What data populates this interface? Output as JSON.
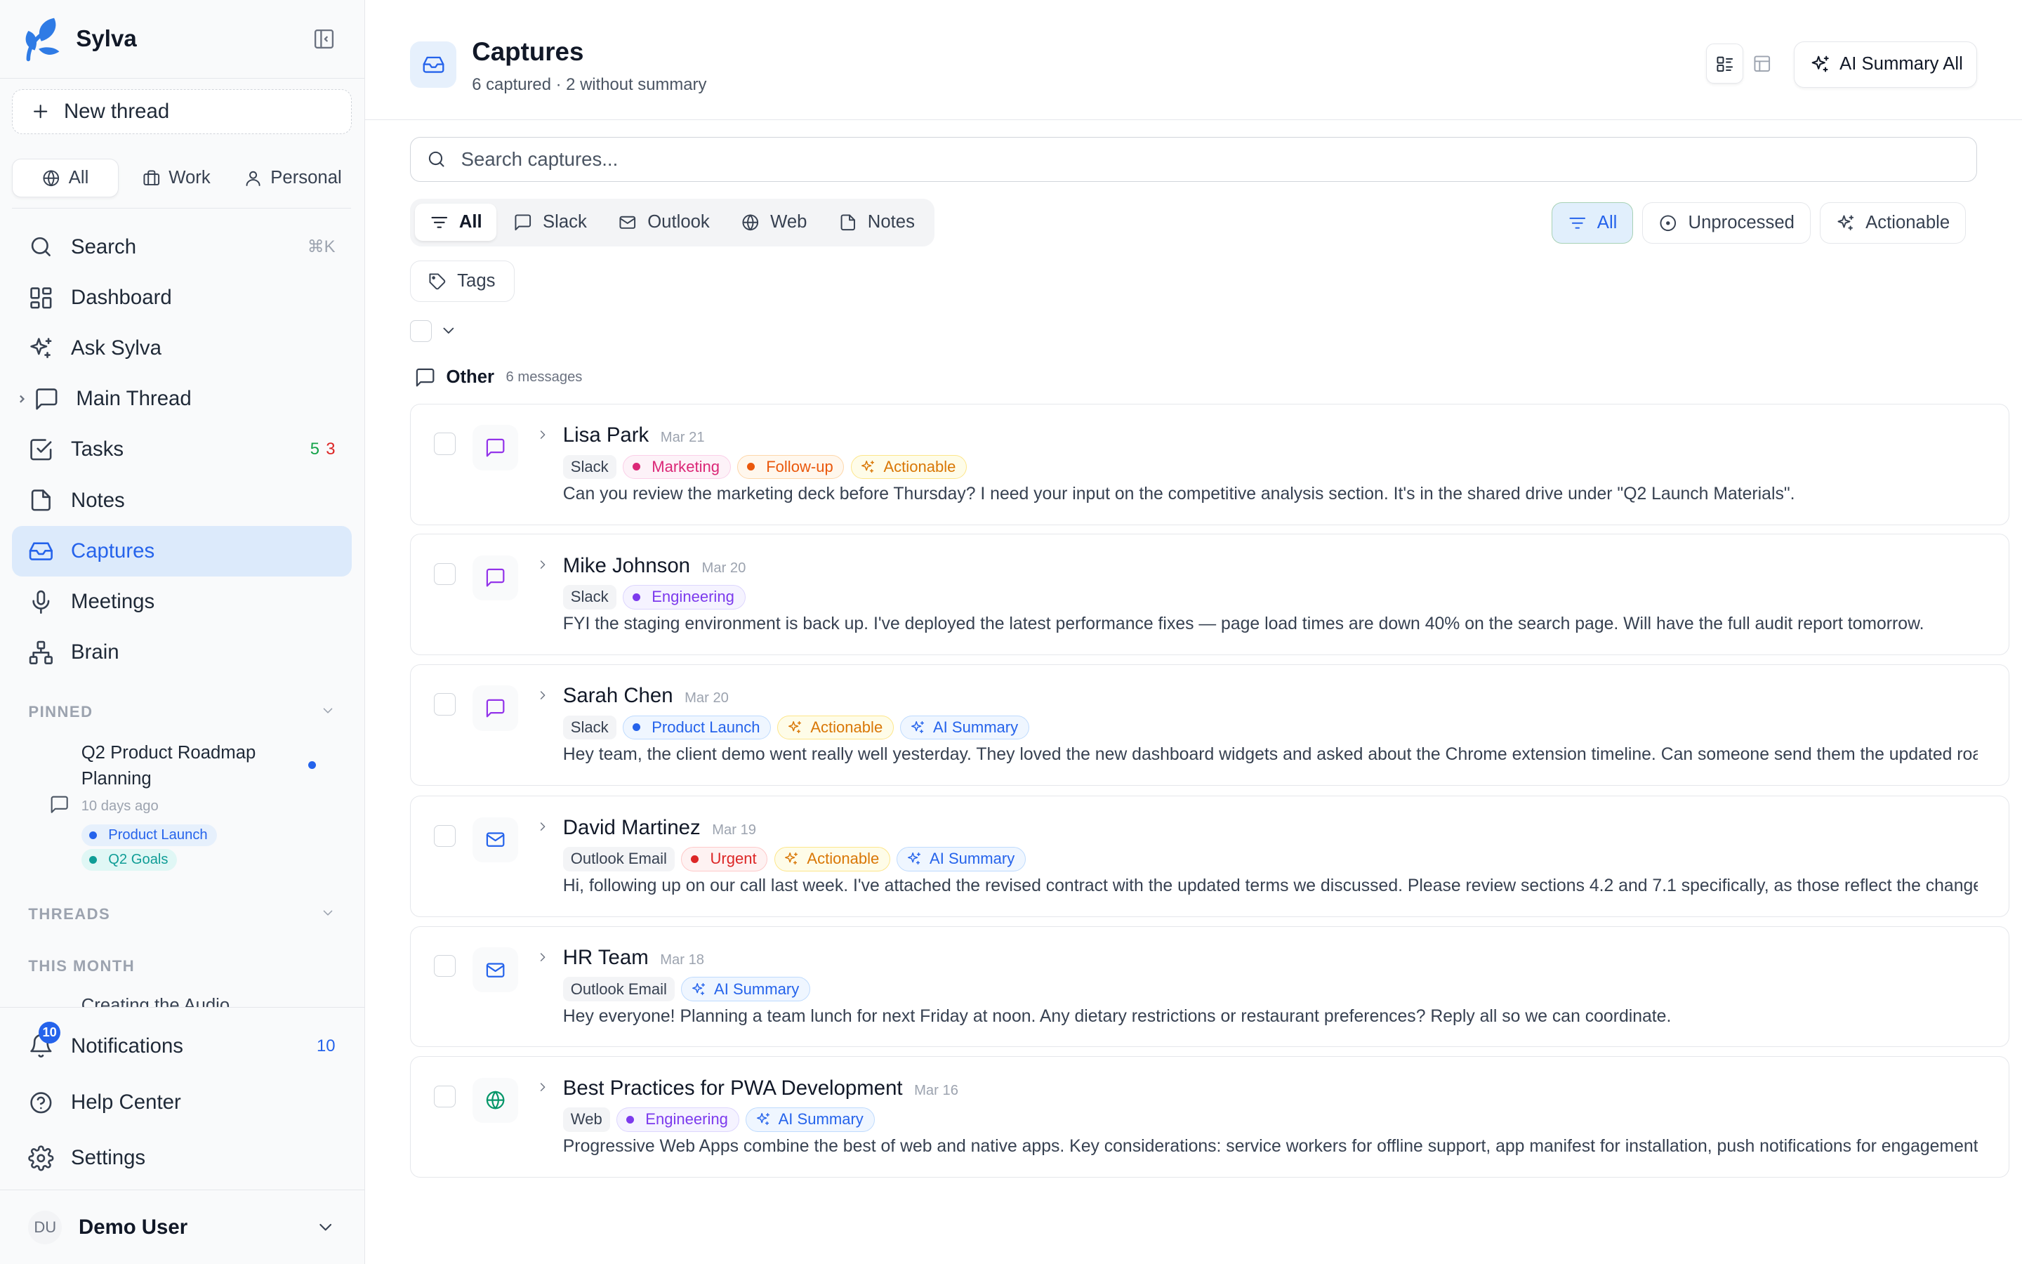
{
  "app": {
    "name": "Sylva"
  },
  "sidebar": {
    "new_thread": "New thread",
    "scopes": [
      {
        "label": "All"
      },
      {
        "label": "Work"
      },
      {
        "label": "Personal"
      }
    ],
    "nav": [
      {
        "label": "Search",
        "kbd": "⌘K",
        "icon": "search-icon"
      },
      {
        "label": "Dashboard",
        "icon": "dashboard-icon"
      },
      {
        "label": "Ask Sylva",
        "icon": "sparkles-icon"
      },
      {
        "label": "Main Thread",
        "icon": "message-square-icon"
      },
      {
        "label": "Tasks",
        "count_done": "5",
        "count_open": "3",
        "icon": "check-square-icon"
      },
      {
        "label": "Notes",
        "icon": "file-icon"
      },
      {
        "label": "Captures",
        "icon": "inbox-icon",
        "active": true
      },
      {
        "label": "Meetings",
        "icon": "mic-icon"
      },
      {
        "label": "Brain",
        "icon": "network-icon"
      }
    ],
    "pinned_label": "PINNED",
    "pinned": {
      "title": "Q2 Product Roadmap Planning",
      "time": "10 days ago",
      "tags": [
        {
          "label": "Product Launch",
          "color": "#2563eb",
          "bg": "#e6f0fc"
        },
        {
          "label": "Q2 Goals",
          "color": "#0f9d96",
          "bg": "#e0f7f5"
        }
      ]
    },
    "threads_label": "THREADS",
    "this_month_label": "THIS MONTH",
    "thread_item": "Creating the Audio",
    "bottom": {
      "notifications": "Notifications",
      "notifications_count": "10",
      "help": "Help Center",
      "settings": "Settings",
      "user_initials": "DU",
      "user_name": "Demo User"
    }
  },
  "main": {
    "title": "Captures",
    "subtitle": "6 captured · 2 without summary",
    "ai_summary_all": "AI Summary All",
    "search_placeholder": "Search captures...",
    "source_tabs": [
      {
        "label": "All",
        "icon": "filter-icon"
      },
      {
        "label": "Slack",
        "icon": "message-square-icon"
      },
      {
        "label": "Outlook",
        "icon": "mail-icon"
      },
      {
        "label": "Web",
        "icon": "globe-icon"
      },
      {
        "label": "Notes",
        "icon": "file-icon"
      }
    ],
    "status_filters": [
      {
        "label": "All"
      },
      {
        "label": "Unprocessed"
      },
      {
        "label": "Actionable"
      }
    ],
    "tags_button": "Tags",
    "group": {
      "name": "Other",
      "count": "6 messages"
    },
    "captures": [
      {
        "sender": "Lisa Park",
        "date": "Mar 21",
        "source": "Slack",
        "icon": "message-square-icon",
        "icon_color": "#9333ea",
        "tags": [
          {
            "label": "Marketing",
            "kind": "dot",
            "color": "#db2777",
            "bg": "#fdf2f8",
            "border": "#fbcfe8"
          },
          {
            "label": "Follow-up",
            "kind": "dot",
            "color": "#ea580c",
            "bg": "#fff7ed",
            "border": "#fed7aa"
          },
          {
            "label": "Actionable",
            "kind": "sparkle",
            "color": "#d97706",
            "bg": "#fefce8",
            "border": "#fde68a"
          }
        ],
        "preview": "Can you review the marketing deck before Thursday? I need your input on the competitive analysis section. It's in the shared drive under \"Q2 Launch Materials\"."
      },
      {
        "sender": "Mike Johnson",
        "date": "Mar 20",
        "source": "Slack",
        "icon": "message-square-icon",
        "icon_color": "#9333ea",
        "tags": [
          {
            "label": "Engineering",
            "kind": "dot",
            "color": "#7c3aed",
            "bg": "#f5f3ff",
            "border": "#ddd6fe"
          }
        ],
        "preview": "FYI the staging environment is back up. I've deployed the latest performance fixes — page load times are down 40% on the search page. Will have the full audit report tomorrow."
      },
      {
        "sender": "Sarah Chen",
        "date": "Mar 20",
        "source": "Slack",
        "icon": "message-square-icon",
        "icon_color": "#9333ea",
        "tags": [
          {
            "label": "Product Launch",
            "kind": "dot",
            "color": "#2563eb",
            "bg": "#eff6ff",
            "border": "#bfdbfe"
          },
          {
            "label": "Actionable",
            "kind": "sparkle",
            "color": "#d97706",
            "bg": "#fefce8",
            "border": "#fde68a"
          },
          {
            "label": "AI Summary",
            "kind": "sparkle",
            "color": "#2563eb",
            "bg": "#eff6ff",
            "border": "#bfdbfe"
          }
        ],
        "preview": "Hey team, the client demo went really well yesterday. They loved the new dashboard widgets and asked about the Chrome extension timeline. Can someone send them the updated roadmap?"
      },
      {
        "sender": "David Martinez",
        "date": "Mar 19",
        "source": "Outlook Email",
        "icon": "mail-icon",
        "icon_color": "#2563eb",
        "tags": [
          {
            "label": "Urgent",
            "kind": "dot",
            "color": "#dc2626",
            "bg": "#fef2f2",
            "border": "#fecaca"
          },
          {
            "label": "Actionable",
            "kind": "sparkle",
            "color": "#d97706",
            "bg": "#fefce8",
            "border": "#fde68a"
          },
          {
            "label": "AI Summary",
            "kind": "sparkle",
            "color": "#2563eb",
            "bg": "#eff6ff",
            "border": "#bfdbfe"
          }
        ],
        "preview": "Hi, following up on our call last week. I've attached the revised contract with the updated terms we discussed. Please review sections 4.2 and 7.1 specifically, as those reflect the changes."
      },
      {
        "sender": "HR Team",
        "date": "Mar 18",
        "source": "Outlook Email",
        "icon": "mail-icon",
        "icon_color": "#2563eb",
        "tags": [
          {
            "label": "AI Summary",
            "kind": "sparkle",
            "color": "#2563eb",
            "bg": "#eff6ff",
            "border": "#bfdbfe"
          }
        ],
        "preview": "Hey everyone! Planning a team lunch for next Friday at noon. Any dietary restrictions or restaurant preferences? Reply all so we can coordinate."
      },
      {
        "sender": "Best Practices for PWA Development",
        "date": "Mar 16",
        "source": "Web",
        "icon": "globe-icon",
        "icon_color": "#059669",
        "tags": [
          {
            "label": "Engineering",
            "kind": "dot",
            "color": "#7c3aed",
            "bg": "#f5f3ff",
            "border": "#ddd6fe"
          },
          {
            "label": "AI Summary",
            "kind": "sparkle",
            "color": "#2563eb",
            "bg": "#eff6ff",
            "border": "#bfdbfe"
          }
        ],
        "preview": "Progressive Web Apps combine the best of web and native apps. Key considerations: service workers for offline support, app manifest for installation, push notifications for engagement."
      }
    ]
  }
}
